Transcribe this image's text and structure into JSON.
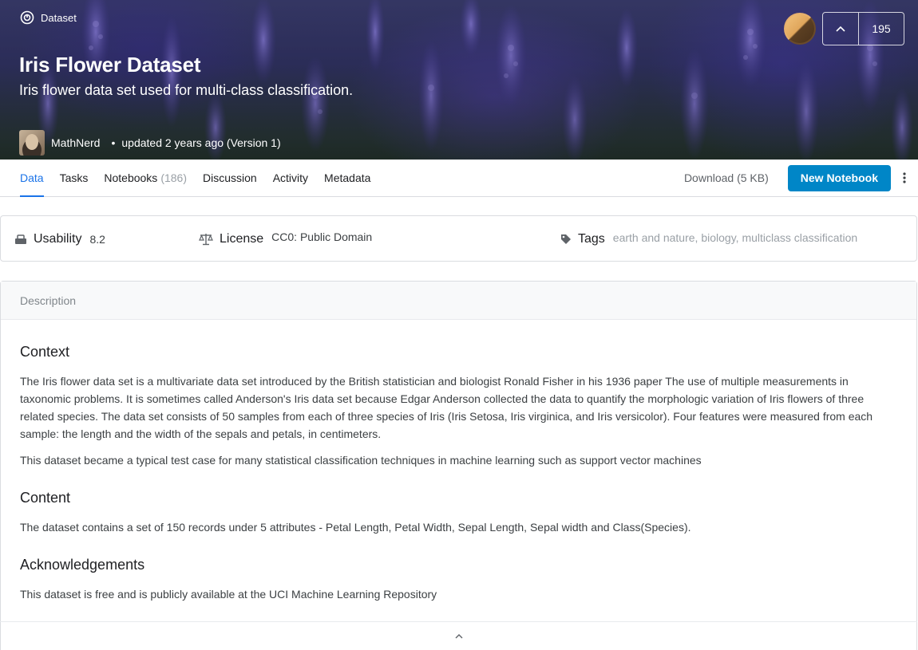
{
  "banner": {
    "type_label": "Dataset",
    "title": "Iris Flower Dataset",
    "subtitle": "Iris flower data set used for multi-class classification.",
    "author": "MathNerd",
    "updated": "updated 2 years ago (Version 1)",
    "dot": "•",
    "vote_count": "195"
  },
  "tabs": [
    {
      "label": "Data",
      "count": ""
    },
    {
      "label": "Tasks",
      "count": ""
    },
    {
      "label": "Notebooks",
      "count": "(186)"
    },
    {
      "label": "Discussion",
      "count": ""
    },
    {
      "label": "Activity",
      "count": ""
    },
    {
      "label": "Metadata",
      "count": ""
    }
  ],
  "actions": {
    "download_label": "Download (5 KB)",
    "new_notebook_label": "New Notebook"
  },
  "info": {
    "usability_label": "Usability",
    "usability_value": "8.2",
    "license_label": "License",
    "license_value": "CC0: Public Domain",
    "tags_label": "Tags",
    "tags": [
      "earth and nature",
      "biology",
      "multiclass classification"
    ]
  },
  "description": {
    "header": "Description",
    "context_heading": "Context",
    "context_p1": "The Iris flower data set is a multivariate data set introduced by the British statistician and biologist Ronald Fisher in his 1936 paper The use of multiple measurements in taxonomic problems. It is sometimes called Anderson's Iris data set because Edgar Anderson collected the data to quantify the morphologic variation of Iris flowers of three related species. The data set consists of 50 samples from each of three species of Iris (Iris Setosa, Iris virginica, and Iris versicolor). Four features were measured from each sample: the length and the width of the sepals and petals, in centimeters.",
    "context_p2": "This dataset became a typical test case for many statistical classification techniques in machine learning such as support vector machines",
    "content_heading": "Content",
    "content_p": "The dataset contains a set of 150 records under 5 attributes - Petal Length, Petal Width, Sepal Length, Sepal width and Class(Species).",
    "ack_heading": "Acknowledgements",
    "ack_p": "This dataset is free and is publicly available at the UCI Machine Learning Repository"
  },
  "colors": {
    "accent": "#1a73e8",
    "button": "#0086c7",
    "banner_purple": "#3a3c6e"
  },
  "icons": {
    "dataset": "dataset-icon",
    "upvote": "chevron-up-icon",
    "more": "kebab-menu-icon",
    "usability": "usability-icon",
    "license": "scale-icon",
    "tags": "tag-icon",
    "collapse": "chevron-up-icon"
  }
}
